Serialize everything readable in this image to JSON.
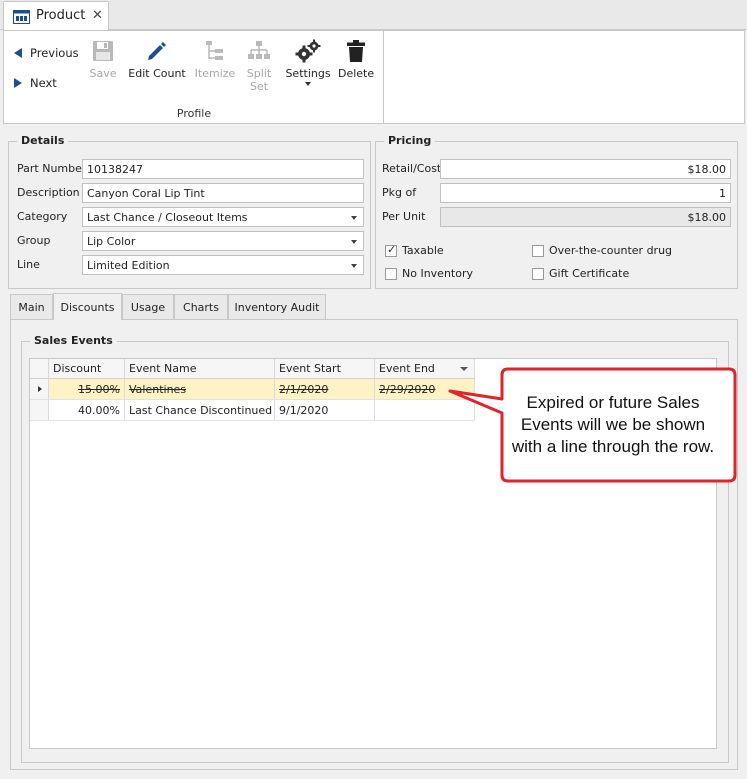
{
  "tab": {
    "title": "Product",
    "close": "✕"
  },
  "ribbon": {
    "previous": "Previous",
    "next": "Next",
    "save": "Save",
    "edit_count": "Edit Count",
    "itemize": "Itemize",
    "split_set_line1": "Split",
    "split_set_line2": "Set",
    "settings": "Settings",
    "delete": "Delete",
    "group_label": "Profile"
  },
  "details": {
    "title": "Details",
    "part_number_label": "Part Number",
    "part_number": "10138247",
    "description_label": "Description",
    "description": "Canyon Coral Lip Tint",
    "category_label": "Category",
    "category": "Last Chance / Closeout Items",
    "group_label": "Group",
    "group": "Lip Color",
    "line_label": "Line",
    "line": "Limited Edition"
  },
  "pricing": {
    "title": "Pricing",
    "retail_label": "Retail/Cost",
    "retail": "$18.00",
    "pkg_label": "Pkg of",
    "pkg": "1",
    "per_unit_label": "Per Unit",
    "per_unit": "$18.00",
    "taxable": "Taxable",
    "taxable_checked": true,
    "otc": "Over-the-counter drug",
    "no_inventory": "No Inventory",
    "gift_certificate": "Gift Certificate"
  },
  "tabs": {
    "main": "Main",
    "discounts": "Discounts",
    "usage": "Usage",
    "charts": "Charts",
    "inventory_audit": "Inventory Audit",
    "active": "Discounts"
  },
  "sales_events": {
    "title": "Sales Events",
    "columns": [
      "Discount",
      "Event Name",
      "Event Start",
      "Event End"
    ],
    "rows": [
      {
        "discount": "15.00%",
        "name": "Valentines",
        "start": "2/1/2020",
        "end": "2/29/2020",
        "expired": true
      },
      {
        "discount": "40.00%",
        "name": "Last Chance Discontinued I...",
        "start": "9/1/2020",
        "end": "",
        "expired": false
      }
    ]
  },
  "callout": {
    "line1": "Expired or future Sales",
    "line2": "Events will we be shown",
    "line3": "with a line through the row.",
    "border_color": "#e0242b"
  },
  "colors": {
    "accent": "#1f4e8c",
    "highlight_row": "#fdf3c4"
  }
}
